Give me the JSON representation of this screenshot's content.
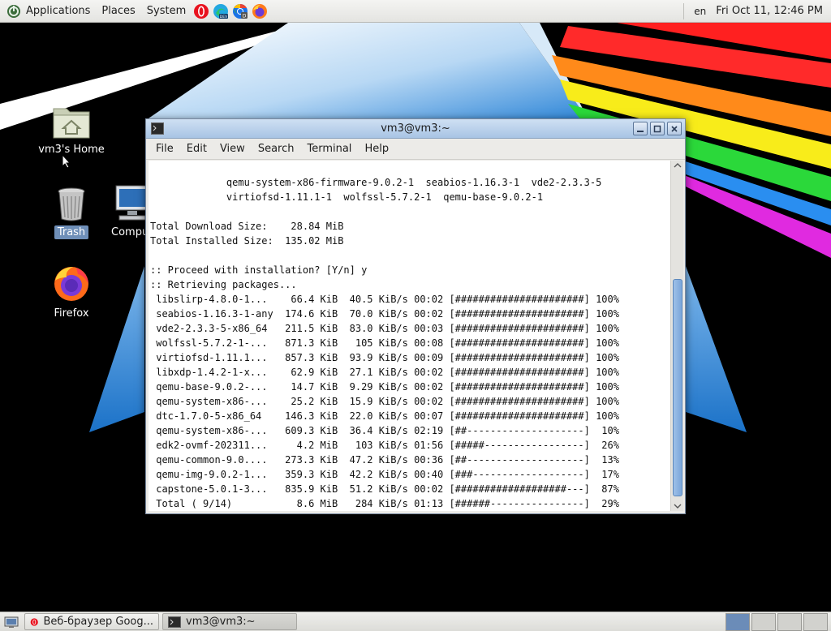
{
  "top_panel": {
    "applications": "Applications",
    "places": "Places",
    "system": "System",
    "launchers": [
      "opera-icon",
      "edge-dev-icon",
      "chrome-dev-icon",
      "firefox-icon"
    ],
    "lang": "en",
    "clock": "Fri Oct 11, 12:46 PM"
  },
  "desktop": {
    "home_label": "vm3's Home",
    "trash_label": "Trash",
    "computer_label": "Computer",
    "firefox_label": "Firefox"
  },
  "terminal": {
    "title": "vm3@vm3:~",
    "menu": [
      "File",
      "Edit",
      "View",
      "Search",
      "Terminal",
      "Help"
    ],
    "lines": [
      "             qemu-system-x86-firmware-9.0.2-1  seabios-1.16.3-1  vde2-2.3.3-5",
      "             virtiofsd-1.11.1-1  wolfssl-5.7.2-1  qemu-base-9.0.2-1",
      "",
      "Total Download Size:    28.84 MiB",
      "Total Installed Size:  135.02 MiB",
      "",
      ":: Proceed with installation? [Y/n] y",
      ":: Retrieving packages...",
      " libslirp-4.8.0-1...    66.4 KiB  40.5 KiB/s 00:02 [######################] 100%",
      " seabios-1.16.3-1-any  174.6 KiB  70.0 KiB/s 00:02 [######################] 100%",
      " vde2-2.3.3-5-x86_64   211.5 KiB  83.0 KiB/s 00:03 [######################] 100%",
      " wolfssl-5.7.2-1-...   871.3 KiB   105 KiB/s 00:08 [######################] 100%",
      " virtiofsd-1.11.1...   857.3 KiB  93.9 KiB/s 00:09 [######################] 100%",
      " libxdp-1.4.2-1-x...    62.9 KiB  27.1 KiB/s 00:02 [######################] 100%",
      " qemu-base-9.0.2-...    14.7 KiB  9.29 KiB/s 00:02 [######################] 100%",
      " qemu-system-x86-...    25.2 KiB  15.9 KiB/s 00:02 [######################] 100%",
      " dtc-1.7.0-5-x86_64    146.3 KiB  22.0 KiB/s 00:07 [######################] 100%",
      " qemu-system-x86-...   609.3 KiB  36.4 KiB/s 02:19 [##--------------------]  10%",
      " edk2-ovmf-202311...     4.2 MiB   103 KiB/s 01:56 [#####-----------------]  26%",
      " qemu-common-9.0....   273.3 KiB  47.2 KiB/s 00:36 [##--------------------]  13%",
      " qemu-img-9.0.2-1...   359.3 KiB  42.2 KiB/s 00:40 [###-------------------]  17%",
      " capstone-5.0.1-3...   835.9 KiB  51.2 KiB/s 00:02 [###################---]  87%",
      " Total ( 9/14)           8.6 MiB   284 KiB/s 01:13 [######----------------]  29%"
    ]
  },
  "taskbar": {
    "tasks": [
      "Веб-браузер Goog...",
      "vm3@vm3:~"
    ],
    "workspaces": 4
  },
  "colors": {
    "panel": "#e8e8e5",
    "titlebar": "#b6cde9",
    "selection": "#6f8fb8"
  }
}
